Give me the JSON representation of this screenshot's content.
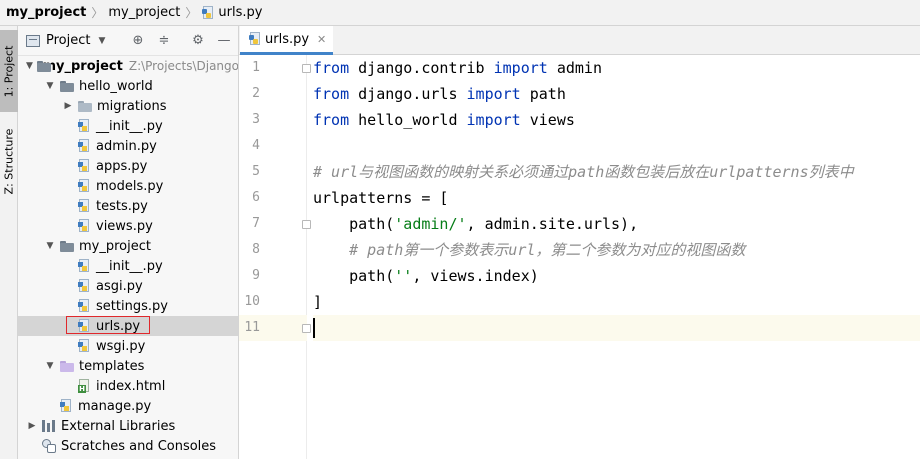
{
  "breadcrumb": {
    "project": "my_project",
    "folder": "my_project",
    "file": "urls.py"
  },
  "toolstrip": {
    "project_tab": "1: Project",
    "structure_tab": "Z: Structure"
  },
  "panel": {
    "title": "Project",
    "root_name": "my_project",
    "root_path": "Z:\\Projects\\Django"
  },
  "tree": {
    "hello_world": "hello_world",
    "migrations": "migrations",
    "hw_init": "__init__.py",
    "hw_admin": "admin.py",
    "hw_apps": "apps.py",
    "hw_models": "models.py",
    "hw_tests": "tests.py",
    "hw_views": "views.py",
    "my_project": "my_project",
    "mp_init": "__init__.py",
    "mp_asgi": "asgi.py",
    "mp_settings": "settings.py",
    "mp_urls": "urls.py",
    "mp_wsgi": "wsgi.py",
    "templates": "templates",
    "index_html": "index.html",
    "manage": "manage.py",
    "external_libraries": "External Libraries",
    "scratches": "Scratches and Consoles"
  },
  "editor": {
    "tab_label": "urls.py",
    "line_numbers": [
      "1",
      "2",
      "3",
      "4",
      "5",
      "6",
      "7",
      "8",
      "9",
      "10",
      "11"
    ],
    "l1_kw1": "from",
    "l1_mod": " django.contrib ",
    "l1_kw2": "import",
    "l1_name": " admin",
    "l2_kw1": "from",
    "l2_mod": " django.urls ",
    "l2_kw2": "import",
    "l2_name": " path",
    "l3_kw1": "from",
    "l3_mod": " hello_world ",
    "l3_kw2": "import",
    "l3_name": " views",
    "l5_comment": "# url与视图函数的映射关系必须通过path函数包装后放在urlpatterns列表中",
    "l6": "urlpatterns = [",
    "l7_a": "    path(",
    "l7_str": "'admin/'",
    "l7_b": ", admin.site.urls),",
    "l8_comment": "    # path第一个参数表示url，第二个参数为对应的视图函数",
    "l9_a": "    path(",
    "l9_str": "''",
    "l9_b": ", views.index)",
    "l10": "]"
  }
}
